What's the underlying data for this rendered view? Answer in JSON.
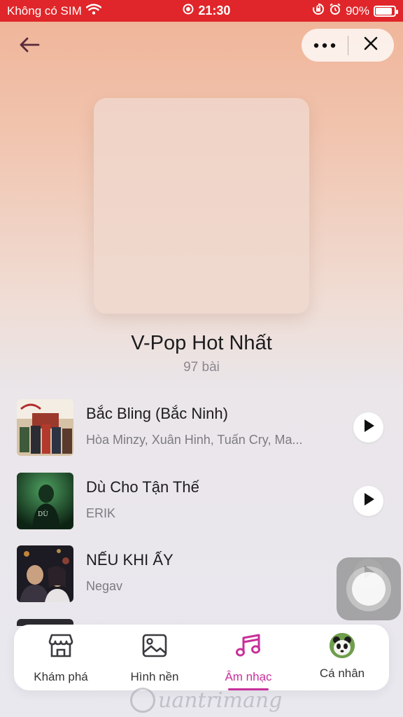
{
  "status_bar": {
    "carrier": "Không có SIM",
    "time": "21:30",
    "battery_percent": "90%",
    "battery_level": 0.9,
    "background": "#e0262a"
  },
  "header": {
    "back_icon": "arrow-left-icon",
    "more_icon": "more-dots-icon",
    "close_icon": "close-icon"
  },
  "playlist": {
    "title": "V-Pop Hot Nhất",
    "count": "97 bài"
  },
  "songs": [
    {
      "title": "Bắc Bling (Bắc Ninh)",
      "artist": "Hòa Minzy, Xuân Hinh, Tuấn Cry, Ma..."
    },
    {
      "title": "Dù Cho Tận Thế",
      "artist": "ERIK"
    },
    {
      "title": "NẾU KHI ẤY",
      "artist": "Negav"
    }
  ],
  "bottom_nav": {
    "items": [
      {
        "label": "Khám phá",
        "icon": "store-icon"
      },
      {
        "label": "Hình nền",
        "icon": "image-icon"
      },
      {
        "label": "Âm nhạc",
        "icon": "music-note-icon",
        "active": true
      },
      {
        "label": "Cá nhân",
        "icon": "panda-avatar"
      }
    ],
    "active_color": "#c7309a"
  },
  "watermark": "uantrimang"
}
